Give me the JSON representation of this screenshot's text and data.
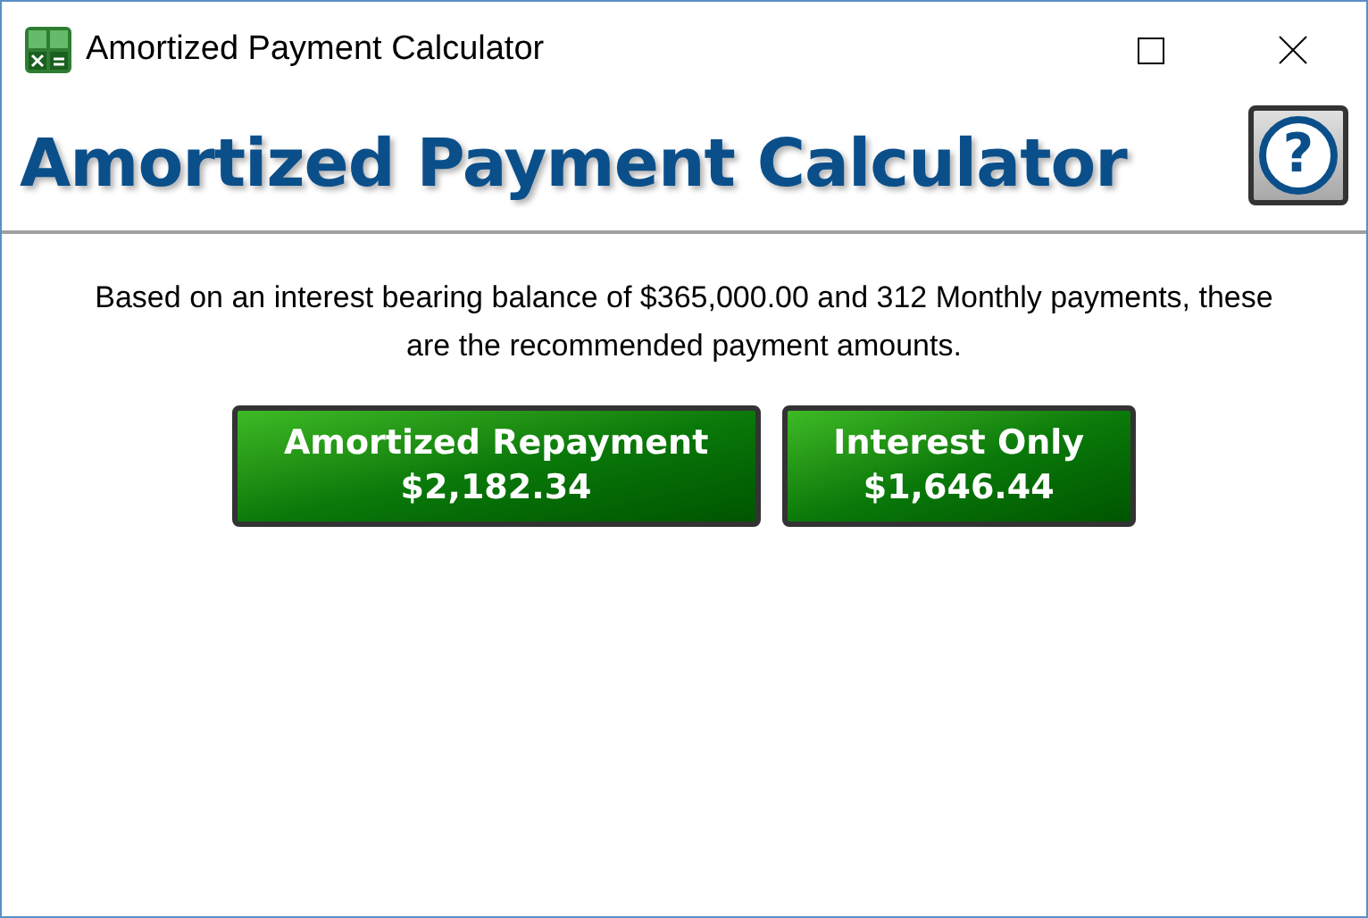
{
  "window": {
    "title": "Amortized Payment Calculator"
  },
  "header": {
    "title": "Amortized Payment Calculator",
    "help": "?"
  },
  "summary": "Based on an interest bearing balance of $365,000.00 and 312 Monthly payments, these are the recommended payment amounts.",
  "options": [
    {
      "label": "Amortized Repayment",
      "amount": "$2,182.34"
    },
    {
      "label": "Interest Only",
      "amount": "$1,646.44"
    }
  ]
}
